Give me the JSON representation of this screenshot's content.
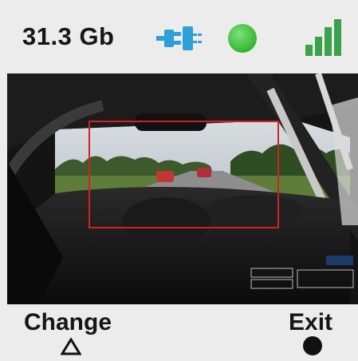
{
  "status": {
    "storage_text": "31.3 Gb",
    "power_icon": "power-plug-icon",
    "recording_icon": "green-status-dot-icon",
    "signal_icon": "signal-bars-icon",
    "status_color": "#3cc43c",
    "accent_color": "#2ea0d6"
  },
  "preview": {
    "framing_box_color": "#d62020"
  },
  "softkeys": {
    "left_label": "Change",
    "left_icon": "triangle-icon",
    "right_label": "Exit",
    "right_icon": "filled-circle-icon"
  }
}
